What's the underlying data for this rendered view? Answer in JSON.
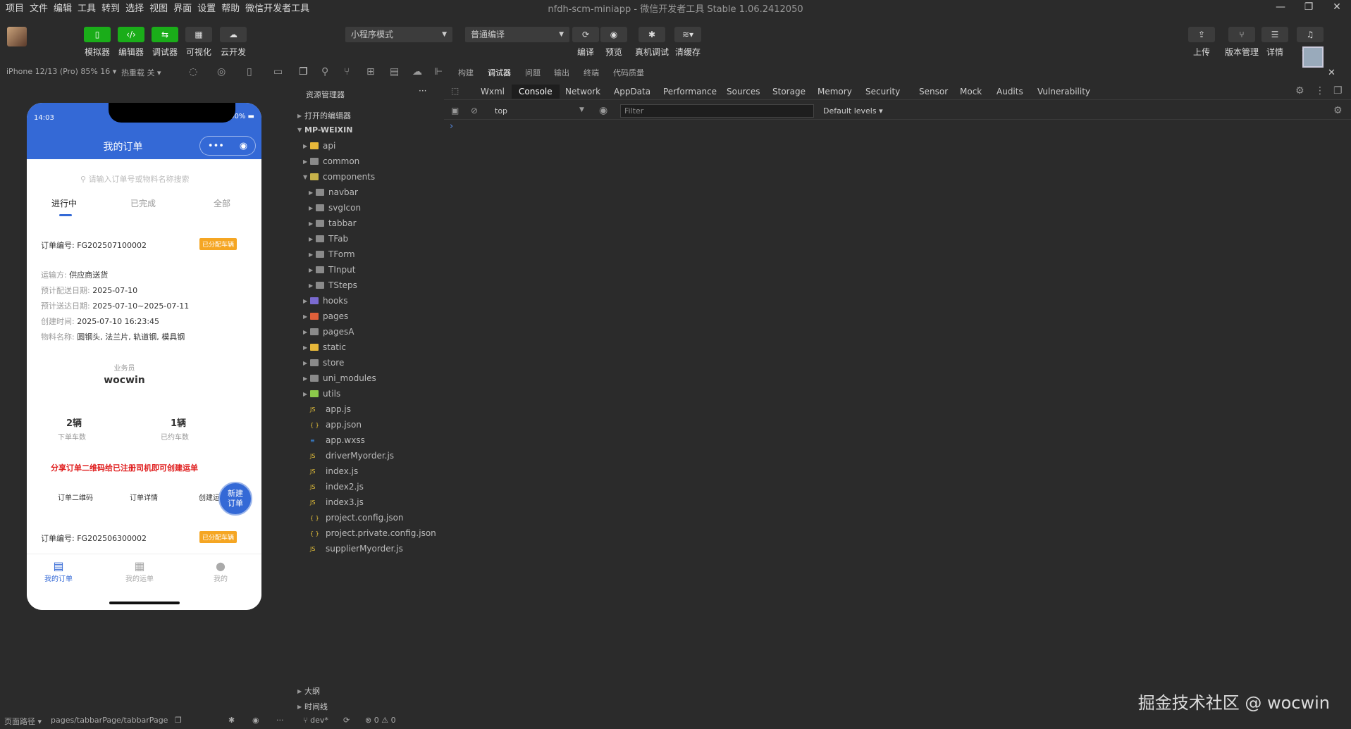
{
  "menu": [
    "项目",
    "文件",
    "编辑",
    "工具",
    "转到",
    "选择",
    "视图",
    "界面",
    "设置",
    "帮助",
    "微信开发者工具"
  ],
  "window_title": "nfdh-scm-miniapp - 微信开发者工具 Stable 1.06.2412050",
  "toolbar": {
    "simulator": "模拟器",
    "editor": "编辑器",
    "debugger": "调试器",
    "visual": "可视化",
    "cloud": "云开发",
    "mode_select": "小程序模式",
    "compile_select": "普通编译",
    "compile": "编译",
    "preview": "预览",
    "real_debug": "真机调试",
    "clear_cache": "清缓存",
    "upload": "上传",
    "version": "版本管理",
    "details": "详情",
    "message": "消息"
  },
  "subbar": {
    "device": "iPhone 12/13 (Pro) 85% 16 ▾",
    "hot_reload": "热重载 关 ▾",
    "tabs": [
      "构建",
      "调试器",
      "问题",
      "输出",
      "终端",
      "代码质量"
    ]
  },
  "phone": {
    "time": "14:03",
    "battery": "100%",
    "title": "我的订单",
    "search_placeholder": "请输入订单号或物料名称搜索",
    "tabs": [
      "进行中",
      "已完成",
      "全部"
    ],
    "order1": {
      "no_label": "订单编号:",
      "no": "FG202507100002",
      "badge": "已分配车辆",
      "fields": [
        {
          "label": "运输方:",
          "value": "供应商送货"
        },
        {
          "label": "预计配送日期:",
          "value": "2025-07-10"
        },
        {
          "label": "预计送达日期:",
          "value": "2025-07-10~2025-07-11"
        },
        {
          "label": "创建时间:",
          "value": "2025-07-10 16:23:45"
        },
        {
          "label": "物料名称:",
          "value": "圆钢头, 法兰片, 轨道钢, 模具钢"
        }
      ],
      "salesman_label": "业务员",
      "salesman": "wocwin",
      "stat1_value": "2辆",
      "stat1_label": "下单车数",
      "stat2_value": "1辆",
      "stat2_label": "已约车数",
      "share_note": "分享订单二维码给已注册司机即可创建运单",
      "actions": [
        "订单二维码",
        "订单详情",
        "创建运单"
      ],
      "fab": "新建订单"
    },
    "order2": {
      "no_label": "订单编号:",
      "no": "FG202506300002",
      "badge": "已分配车辆"
    },
    "tabbar": [
      "我的订单",
      "我的运单",
      "我的"
    ]
  },
  "explorer": {
    "title": "资源管理器",
    "open_editors": "打开的编辑器",
    "root": "MP-WEIXIN",
    "items": [
      {
        "name": "api",
        "type": "folder",
        "color": "#e8b83a",
        "indent": 0,
        "open": false
      },
      {
        "name": "common",
        "type": "folder",
        "color": "#8a8a8a",
        "indent": 0,
        "open": false
      },
      {
        "name": "components",
        "type": "folder",
        "color": "#c7b24a",
        "indent": 0,
        "open": true
      },
      {
        "name": "navbar",
        "type": "folder",
        "color": "#8a8a8a",
        "indent": 1,
        "open": false
      },
      {
        "name": "svgIcon",
        "type": "folder",
        "color": "#8a8a8a",
        "indent": 1,
        "open": false
      },
      {
        "name": "tabbar",
        "type": "folder",
        "color": "#8a8a8a",
        "indent": 1,
        "open": false
      },
      {
        "name": "TFab",
        "type": "folder",
        "color": "#8a8a8a",
        "indent": 1,
        "open": false
      },
      {
        "name": "TForm",
        "type": "folder",
        "color": "#8a8a8a",
        "indent": 1,
        "open": false
      },
      {
        "name": "TInput",
        "type": "folder",
        "color": "#8a8a8a",
        "indent": 1,
        "open": false
      },
      {
        "name": "TSteps",
        "type": "folder",
        "color": "#8a8a8a",
        "indent": 1,
        "open": false
      },
      {
        "name": "hooks",
        "type": "folder",
        "color": "#7a6ad0",
        "indent": 0,
        "open": false
      },
      {
        "name": "pages",
        "type": "folder",
        "color": "#e0603a",
        "indent": 0,
        "open": false
      },
      {
        "name": "pagesA",
        "type": "folder",
        "color": "#8a8a8a",
        "indent": 0,
        "open": false
      },
      {
        "name": "static",
        "type": "folder",
        "color": "#e8b83a",
        "indent": 0,
        "open": false
      },
      {
        "name": "store",
        "type": "folder",
        "color": "#8a8a8a",
        "indent": 0,
        "open": false
      },
      {
        "name": "uni_modules",
        "type": "folder",
        "color": "#8a8a8a",
        "indent": 0,
        "open": false
      },
      {
        "name": "utils",
        "type": "folder",
        "color": "#8cc84b",
        "indent": 0,
        "open": false
      },
      {
        "name": "app.js",
        "type": "js",
        "color": "#e8c33a",
        "indent": 0
      },
      {
        "name": "app.json",
        "type": "json",
        "color": "#e8c33a",
        "indent": 0
      },
      {
        "name": "app.wxss",
        "type": "css",
        "color": "#3a8ee8",
        "indent": 0
      },
      {
        "name": "driverMyorder.js",
        "type": "js",
        "color": "#e8c33a",
        "indent": 0
      },
      {
        "name": "index.js",
        "type": "js",
        "color": "#e8c33a",
        "indent": 0
      },
      {
        "name": "index2.js",
        "type": "js",
        "color": "#e8c33a",
        "indent": 0
      },
      {
        "name": "index3.js",
        "type": "js",
        "color": "#e8c33a",
        "indent": 0
      },
      {
        "name": "project.config.json",
        "type": "json",
        "color": "#e8c33a",
        "indent": 0
      },
      {
        "name": "project.private.config.json",
        "type": "json",
        "color": "#e8c33a",
        "indent": 0
      },
      {
        "name": "supplierMyorder.js",
        "type": "js",
        "color": "#e8c33a",
        "indent": 0
      }
    ],
    "outline": "大纲",
    "timeline": "时间线"
  },
  "devtools": {
    "tabs": [
      "Wxml",
      "Console",
      "Network",
      "AppData",
      "Performance",
      "Sources",
      "Storage",
      "Memory",
      "Security",
      "Sensor",
      "Mock",
      "Audits",
      "Vulnerability"
    ],
    "active_tab": "Console",
    "context": "top",
    "filter_placeholder": "Filter",
    "levels": "Default levels ▾",
    "prompt": "›"
  },
  "statusbar": {
    "page_path_label": "页面路径 ▾",
    "page_path": "pages/tabbarPage/tabbarPage",
    "branch": "dev*",
    "problems": "⊗ 0 ⚠ 0"
  },
  "watermark": "掘金技术社区 @ wocwin"
}
